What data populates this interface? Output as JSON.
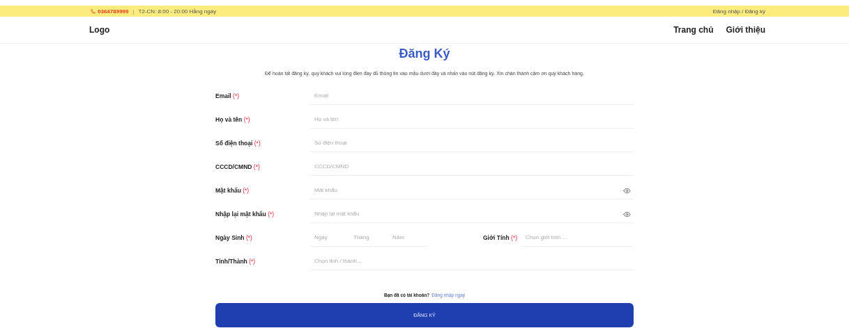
{
  "top_bar": {
    "phone": "0364789999",
    "separator": "|",
    "hours": "T2-CN: 8:00 - 20:00 Hằng ngày",
    "auth_link": "Đăng nhập / Đăng ký"
  },
  "header": {
    "logo": "Logo",
    "nav": [
      {
        "label": "Trang chủ"
      },
      {
        "label": "Giới thiệu"
      }
    ]
  },
  "form": {
    "title": "Đăng Ký",
    "description": "Để hoàn tất đăng ký, quý khách vui lòng điền đầy đủ thông tin vào mẫu dưới đây và nhấn vào nút đăng ký. Xin chân thành cảm ơn quý khách hàng.",
    "required_mark": "(*)",
    "fields": [
      {
        "kind": "text",
        "label": "Email",
        "placeholder": "Email"
      },
      {
        "kind": "text",
        "label": "Họ và tên",
        "placeholder": "Họ và tên"
      },
      {
        "kind": "text",
        "label": "Số điện thoại",
        "placeholder": "Số điện thoại"
      },
      {
        "kind": "text",
        "label": "CCCD/CMND",
        "placeholder": "CCCD/CMND"
      },
      {
        "kind": "password",
        "label": "Mật khẩu",
        "placeholder": "Mật khẩu"
      },
      {
        "kind": "password",
        "label": "Nhập lại mật khẩu",
        "placeholder": "Nhập lại mật khẩu"
      },
      {
        "kind": "birthday",
        "label": "Ngày Sinh",
        "parts": [
          {
            "placeholder": "Ngày"
          },
          {
            "placeholder": "Tháng"
          },
          {
            "placeholder": "Năm"
          }
        ],
        "side_label": "Giới Tính",
        "side_placeholder": "Chọn giới tính ..."
      },
      {
        "kind": "select",
        "label": "Tỉnh/Thành",
        "placeholder": "Chọn tỉnh / thành..."
      }
    ],
    "login_prompt": "Bạn đã có tài khoản?",
    "login_link": "Đăng nhập ngay",
    "submit": "ĐĂNG KÝ"
  }
}
